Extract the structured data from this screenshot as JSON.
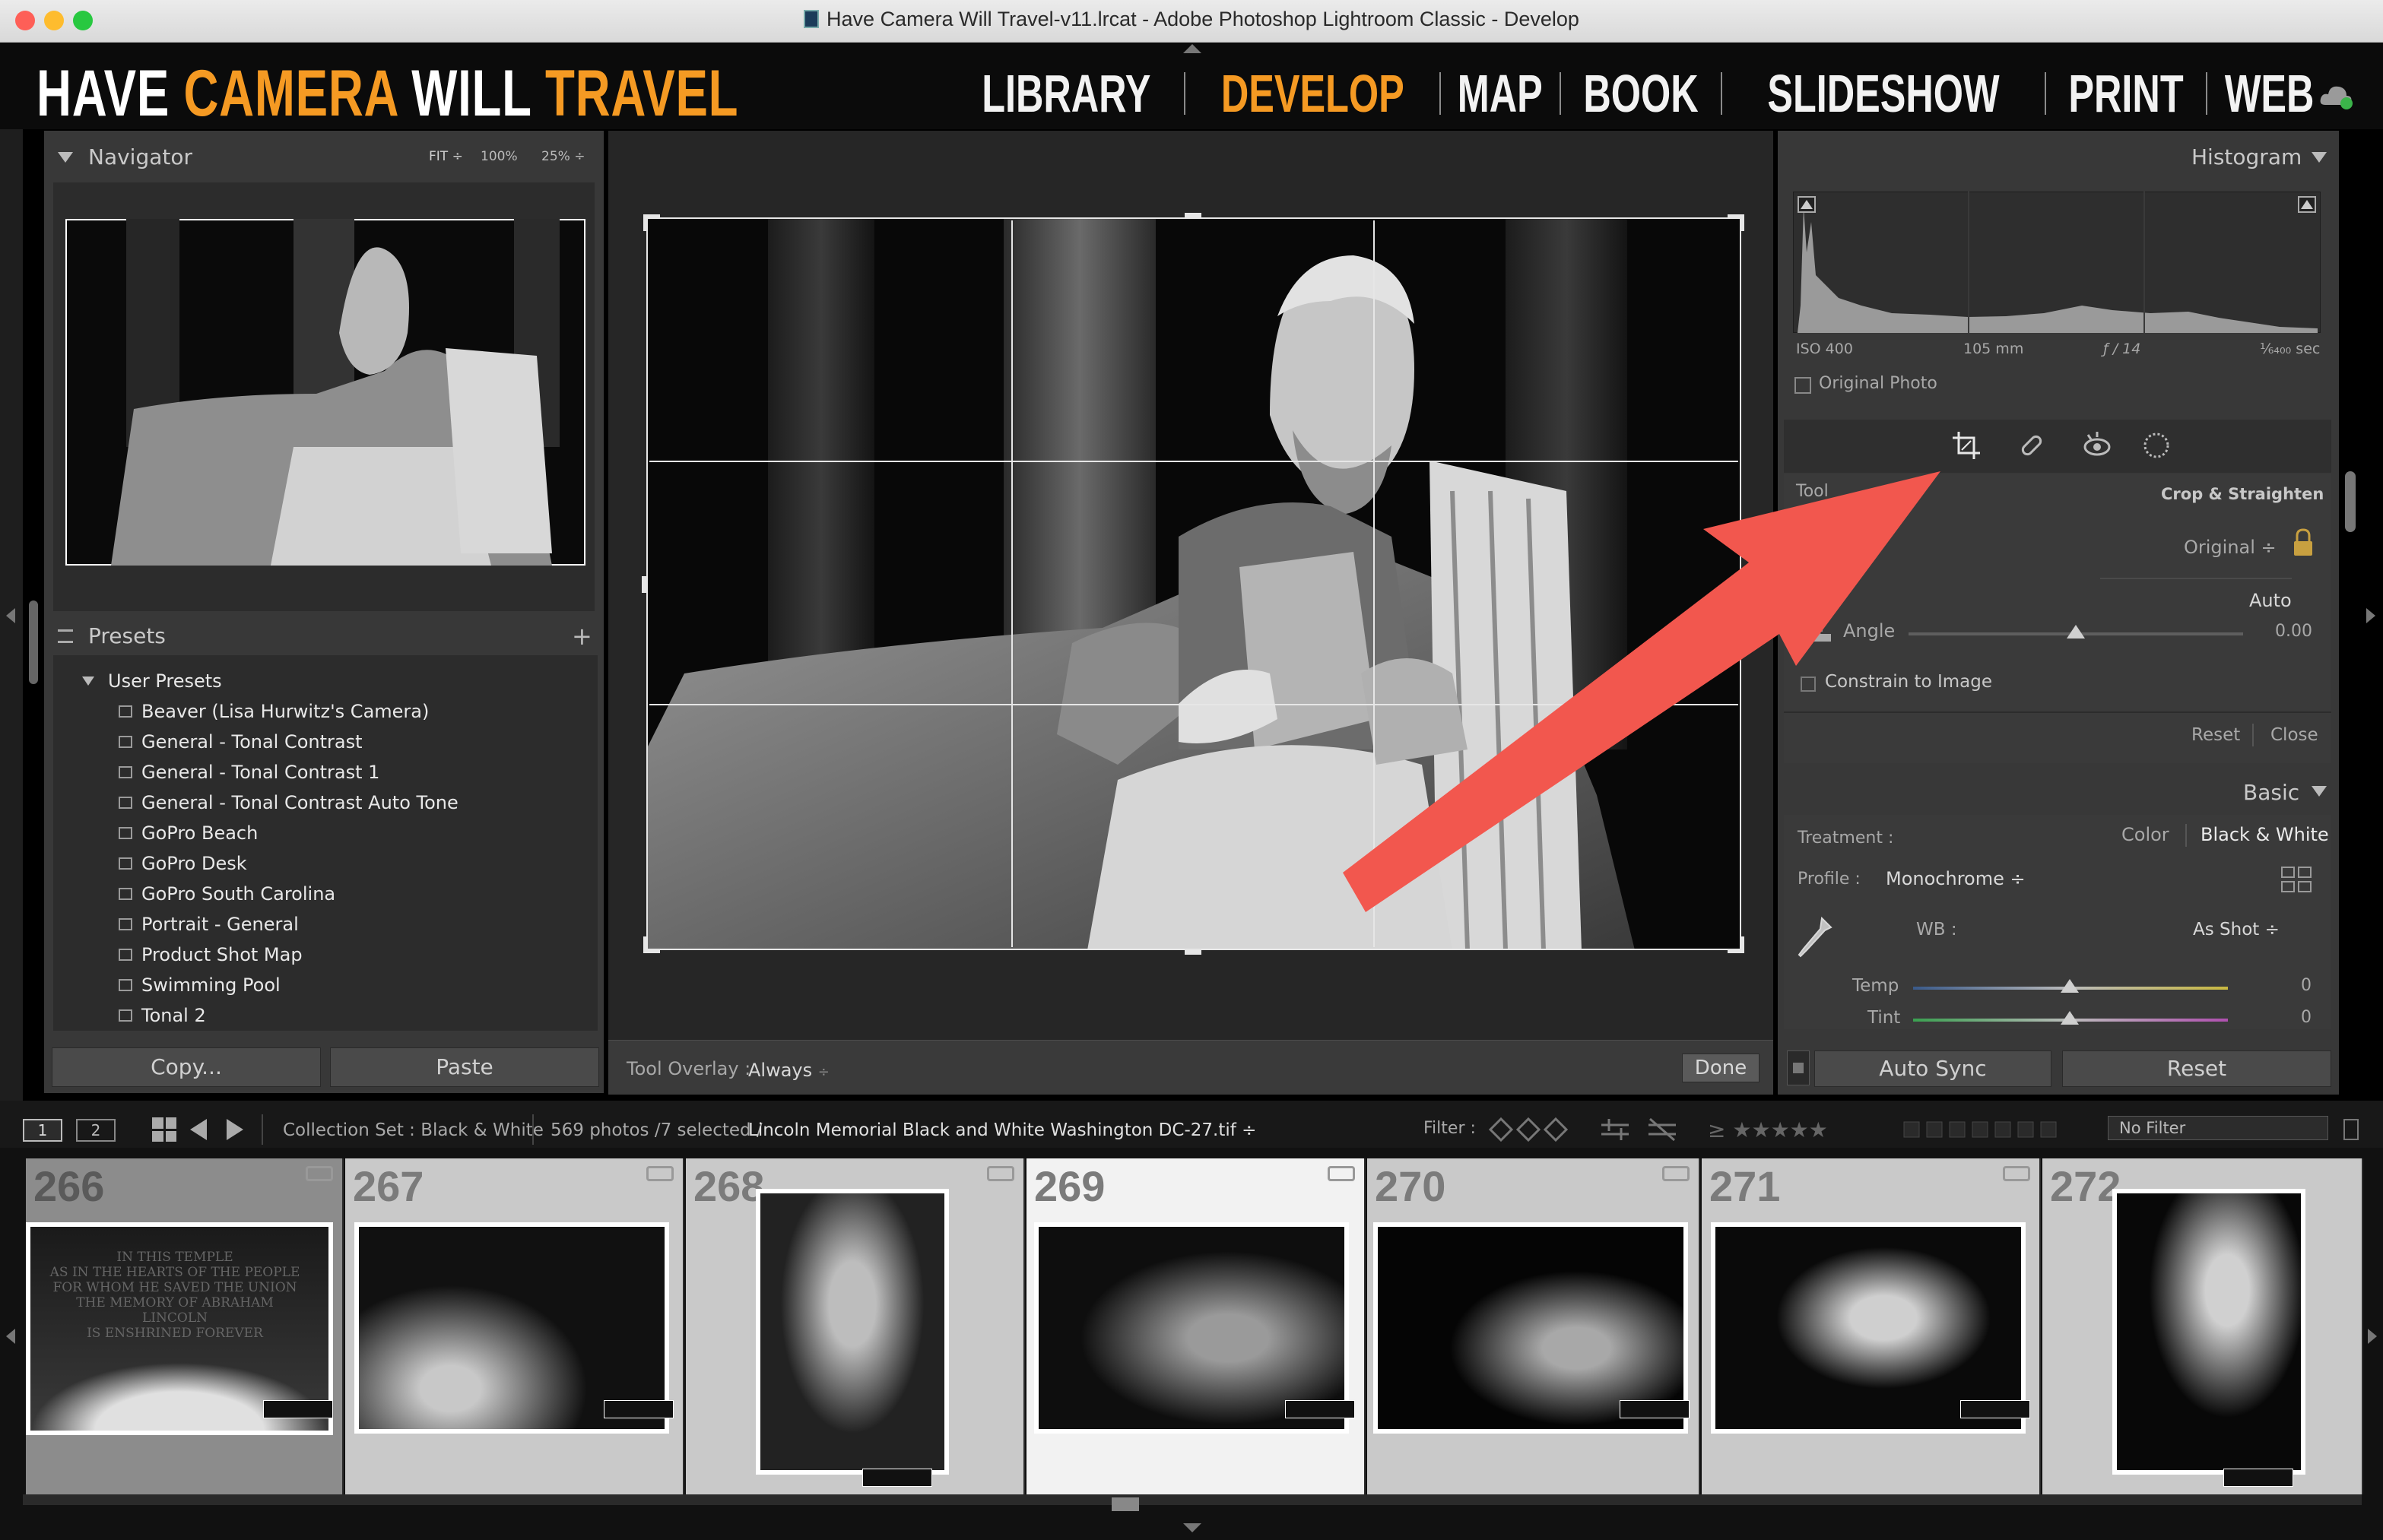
{
  "window": {
    "title": "Have Camera Will Travel-v11.lrcat - Adobe Photoshop Lightroom Classic - Develop"
  },
  "brand": {
    "part1": "HAVE ",
    "part2": "CAMERA",
    "part3": " WILL ",
    "part4": "TRAVEL"
  },
  "modules": [
    {
      "label": "LIBRARY",
      "active": false
    },
    {
      "label": "DEVELOP",
      "active": true
    },
    {
      "label": "MAP",
      "active": false
    },
    {
      "label": "BOOK",
      "active": false
    },
    {
      "label": "SLIDESHOW",
      "active": false
    },
    {
      "label": "PRINT",
      "active": false
    },
    {
      "label": "WEB",
      "active": false
    }
  ],
  "navigator": {
    "title": "Navigator",
    "zoom": [
      "FIT ÷",
      "100%",
      "25% ÷"
    ]
  },
  "presets": {
    "title": "Presets",
    "group": "User Presets",
    "items": [
      "Beaver (Lisa Hurwitz's Camera)",
      "General - Tonal Contrast",
      "General - Tonal Contrast 1",
      "General - Tonal Contrast Auto Tone",
      "GoPro Beach",
      "GoPro Desk",
      "GoPro South Carolina",
      "Portrait - General",
      "Product Shot Map",
      "Swimming Pool",
      "Tonal 2"
    ]
  },
  "left_buttons": {
    "copy": "Copy...",
    "paste": "Paste"
  },
  "toolbar": {
    "overlay_label": "Tool Overlay :",
    "overlay_value": "Always",
    "done": "Done"
  },
  "histogram": {
    "title": "Histogram",
    "iso": "ISO 400",
    "focal": "105 mm",
    "aperture": "ƒ / 14",
    "shutter": "¹⁄₆₄₀₀ sec",
    "original": "Original Photo"
  },
  "crop": {
    "tool_label": "Tool",
    "tool_name": "Crop & Straighten",
    "aspect_value": "Original ÷",
    "auto": "Auto",
    "angle_label": "Angle",
    "angle_value": "0.00",
    "angle_level": 0.5,
    "constrain": "Constrain to Image",
    "reset": "Reset",
    "close": "Close"
  },
  "basic": {
    "title": "Basic",
    "treatment_label": "Treatment :",
    "color": "Color",
    "bw": "Black & White",
    "profile_label": "Profile :",
    "profile_value": "Monochrome ÷",
    "wb_label": "WB :",
    "wb_value": "As Shot ÷",
    "temp_label": "Temp",
    "temp_value": "0",
    "tint_label": "Tint",
    "tint_value": "0"
  },
  "bottom_buttons": {
    "autosync": "Auto Sync",
    "reset": "Reset"
  },
  "filmstrip_bar": {
    "screen1": "1",
    "screen2": "2",
    "collection": "Collection Set : Black & White",
    "count": "569 photos /7 selected /",
    "filename": "Lincoln Memorial Black and White Washington DC-27.tif ÷",
    "filter_label": "Filter :",
    "no_filter": "No Filter"
  },
  "filmstrip": [
    {
      "num": "266"
    },
    {
      "num": "267"
    },
    {
      "num": "268"
    },
    {
      "num": "269"
    },
    {
      "num": "270"
    },
    {
      "num": "271"
    },
    {
      "num": "272"
    }
  ],
  "colors": {
    "accent": "#f59a23",
    "arrow": "#f2574e"
  }
}
